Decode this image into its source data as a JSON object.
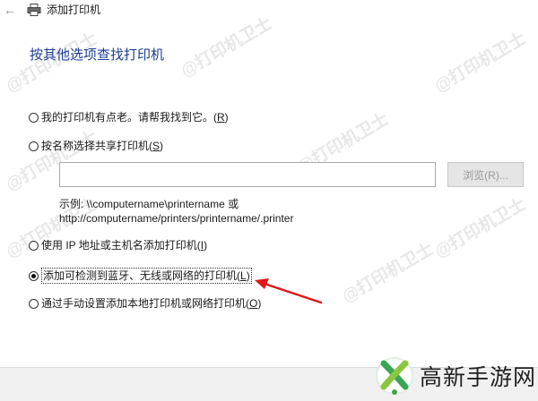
{
  "window": {
    "title": "添加打印机",
    "back_icon": "back-arrow-icon",
    "app_icon": "printer-icon"
  },
  "heading": "按其他选项查找打印机",
  "options": [
    {
      "label": "我的打印机有点老。请帮我找到它。(",
      "key": "R",
      "suffix": ")",
      "selected": false
    },
    {
      "label": "按名称选择共享打印机(",
      "key": "S",
      "suffix": ")",
      "selected": false
    },
    {
      "label": "使用 IP 地址或主机名添加打印机(",
      "key": "I",
      "suffix": ")",
      "selected": false
    },
    {
      "label": "添加可检测到蓝牙、无线或网络的打印机(",
      "key": "L",
      "suffix": ")",
      "selected": true
    },
    {
      "label": "通过手动设置添加本地打印机或网络打印机(",
      "key": "O",
      "suffix": ")",
      "selected": false
    }
  ],
  "share_input": {
    "value": "",
    "placeholder": ""
  },
  "browse_button": "浏览(R)...",
  "example": {
    "line1": "示例: \\\\computername\\printername 或",
    "line2": "http://computername/printers/printername/.printer"
  },
  "watermark": "@打印机卫士",
  "brand": {
    "name": "高新手游网",
    "logo_icon": "brand-logo-icon"
  },
  "colors": {
    "heading": "#1c3f94",
    "arrow": "#e0161b",
    "bottom_band": "#f0f0f0"
  }
}
